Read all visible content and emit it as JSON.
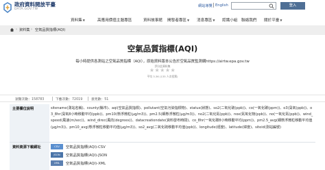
{
  "header": {
    "brand_main": "政府資料開放平臺",
    "brand_sub": "DATA.GOV.TW",
    "links": [
      "網站導覽",
      "English"
    ],
    "search_placeholder": "",
    "login_label": "登入"
  },
  "nav": {
    "items": [
      "資料集",
      "高應用價值主題專區",
      "資料故事館",
      "開發者專區",
      "消息專區",
      "認識小組",
      "聯絡我們",
      "關於平臺"
    ]
  },
  "breadcrumb": {
    "items": [
      "資料集",
      "空氣品質指標(AQI)"
    ]
  },
  "dataset": {
    "title": "空氣品質指標(AQI)",
    "description": "每小時提供各測站之空氣品質指標（AQI），原始資料版本公告於空氣品質監測網https://airtw.epa.gov.tw",
    "rating_label": "評分此資料集",
    "stars": "★★★★★",
    "rating_value": "平均 3.36 (135 人次投票)"
  },
  "stats": [
    "瀏覽次數：158783",
    "下載次數：72019",
    "意見數：51"
  ],
  "fields_row": {
    "label": "主要欄位說明",
    "text": "sitename(測站名稱)、county(縣市)、aqi(空氣品質指標)、pollutant(空氣污染指標物)、status(狀態)、so2(二氧化硫(ppb))、co(一氧化碳(ppm))、o3(臭氧(ppb))、o3_8hr(臭氧8小時移動平均(ppb))、pm10(懸浮微粒(μg/m3))、pm2.5(細懸浮微粒(μg/m3))、no2(二氧化氮(ppb))、nox(氮氧化物(ppb))、no(一氧化氮(ppb))、wind_speed(風速(m/sec))、wind_direc(風向(degrees))、datacreationdate(資料發布時間)、co_8hr(一氧化碳8小時移動平均(ppm))、pm2.5_avg(細懸浮微粒移動平均值(μg/m3))、pm10_avg(懸浮微粒移動平均值(μg/m3))、so2_avg(二氧化硫移動平均值(ppb))、longitude(經度)、latitude(緯度)、siteid(測站編號)"
  },
  "resources_row": {
    "label": "資料資源下載網址",
    "items": [
      {
        "format": "CSV",
        "name": "空氣品質指標(AQI)-CSV"
      },
      {
        "format": "JSON",
        "name": "空氣品質指標(AQI)-JSON"
      },
      {
        "format": "XML",
        "name": "空氣品質指標(AQI)-XML"
      }
    ]
  },
  "colors": {
    "brand": "#1f3b6b",
    "login_bg": "#4f6f95",
    "badge": "#5a8fcf",
    "label_bg": "#eef2f6"
  }
}
